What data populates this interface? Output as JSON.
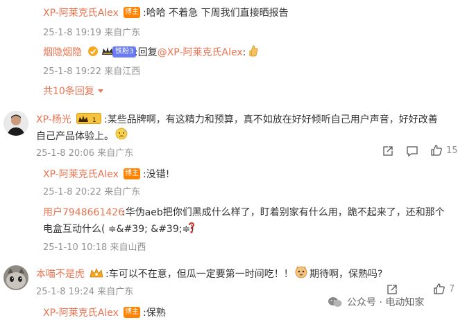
{
  "comments": {
    "r1": {
      "name": "XP-阿莱克氏Alex",
      "badge": "博主",
      "text": ":哈哈 不着急 下周我们直接晒报告",
      "time": "25-1-8 19:19 来自广东"
    },
    "r2": {
      "name": "烟隐烟隐",
      "fans_badge": "铁粉3",
      "text_prefix": ":回复",
      "mention": "@XP-阿莱克氏Alex",
      "text_suffix": ":",
      "time": "25-1-8 19:22 来自江西"
    },
    "more_replies": "共10条回复",
    "c1": {
      "name": "XP-杨光",
      "line1": ":某些品牌啊，有这精力和预算，真不如放在好好倾听自己用户声音，好好改善",
      "line2": "自己产品体验上。",
      "time": "25-1-8 20:06 来自广东",
      "like_count": "15",
      "replies": [
        {
          "name": "XP-阿莱克氏Alex",
          "badge": "博主",
          "text": ":没错!",
          "time": "25-1-8 20:22 来自广东"
        },
        {
          "name": "用户7948661426",
          "line1": ":华伪aeb把你们黑成什么样了，盯着别家有什么用，跪不起来了，还和那个",
          "line2": "电盒互动什么( ≑&#39; &#39;≑)",
          "time": "25-1-10 10:18 来自山西"
        }
      ]
    },
    "c2": {
      "name": "本喵不是虎",
      "text_a": ":车可以不在意，但瓜一定要第一时间吃！！",
      "text_b": "期待啊，保熟吗?",
      "time": "25-1-8 19:24 来自广东",
      "like_count": "7",
      "replies": [
        {
          "name": "XP-阿莱克氏Alex",
          "badge": "博主",
          "text": ":保熟"
        }
      ]
    }
  },
  "watermark": "公众号 · 电动知家",
  "icons": [
    "share-icon",
    "comment-icon",
    "like-icon",
    "thumbs-up-emoji",
    "sweat-emoji",
    "question-emoji",
    "cat-emoji",
    "verified-icon",
    "crown-icon"
  ],
  "colors": {
    "username": "#eb7350",
    "meta": "#939393",
    "badge_bozhu": "#ff8200",
    "badge_fans": "#6a7cf3"
  }
}
